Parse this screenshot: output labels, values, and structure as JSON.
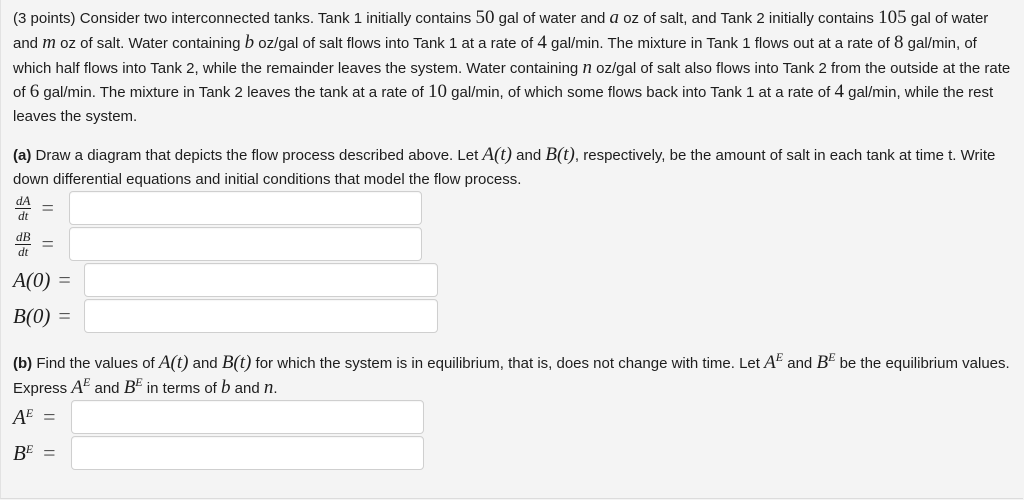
{
  "intro": {
    "s1": "(3 points) Consider two interconnected tanks. Tank 1 initially contains ",
    "v50": "50",
    "s2": " gal of water and ",
    "va": "a",
    "s3": " oz of salt, and Tank 2 initially contains ",
    "v105": "105",
    "s4": " gal of water and ",
    "vm": "m",
    "s5": " oz of salt. Water containing ",
    "vb": "b",
    "s6": " oz/gal of salt flows into Tank 1 at a rate of ",
    "v4a": "4",
    "s7": " gal/min. The mixture in Tank 1 flows out at a rate of ",
    "v8": "8",
    "s8": " gal/min, of which half flows into Tank 2, while the remainder leaves the system. Water containing ",
    "vn": "n",
    "s9": " oz/gal of salt also flows into Tank 2 from the outside at the rate of ",
    "v6": "6",
    "s10": " gal/min. The mixture in Tank 2 leaves the tank at a rate of ",
    "v10": "10",
    "s11": " gal/min, of which some flows back into Tank 1 at a rate of ",
    "v4b": "4",
    "s12": " gal/min, while the rest leaves the system."
  },
  "part_a": {
    "tag": "(a)",
    "s1": " Draw a diagram that depicts the flow process described above. Let ",
    "At": "A(t)",
    "s2": " and ",
    "Bt": "B(t)",
    "s3": ", respectively, be the amount of salt in each tank at time t. Write down differential equations and initial conditions that model the flow process.",
    "fields": [
      {
        "num": "dA",
        "den": "dt",
        "eq": "=",
        "value": ""
      },
      {
        "num": "dB",
        "den": "dt",
        "eq": "=",
        "value": ""
      },
      {
        "label": "A(0)",
        "eq": "=",
        "value": ""
      },
      {
        "label": "B(0)",
        "eq": "=",
        "value": ""
      }
    ]
  },
  "part_b": {
    "tag": "(b)",
    "s1": " Find the values of ",
    "At": "A(t)",
    "s2": " and ",
    "Bt": "B(t)",
    "s3": " for which the system is in equilibrium, that is, does not change with time. Let ",
    "A": "A",
    "sup": "E",
    "s4": " and ",
    "B": "B",
    "s5": " be the equilibrium values. Express ",
    "s6": " and ",
    "s7": " in terms of ",
    "vb": "b",
    "s8": " and ",
    "vn": "n",
    "s9": ".",
    "fields": [
      {
        "label": "A",
        "sup": "E",
        "eq": "=",
        "value": ""
      },
      {
        "label": "B",
        "sup": "E",
        "eq": "=",
        "value": ""
      }
    ]
  }
}
